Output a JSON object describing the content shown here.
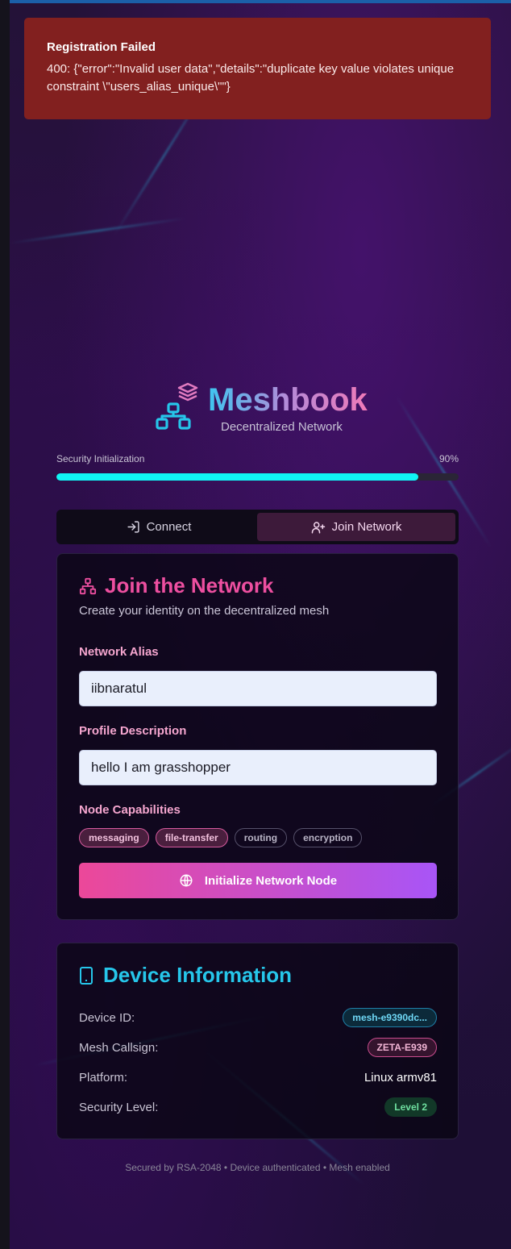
{
  "alert": {
    "title": "Registration Failed",
    "message": "400: {\"error\":\"Invalid user data\",\"details\":\"duplicate key value violates unique constraint \\\"users_alias_unique\\\"\"}"
  },
  "brand": {
    "name": "Meshbook",
    "tagline": "Decentralized Network",
    "icon": "network-stack-icon"
  },
  "security": {
    "label": "Security Initialization",
    "percent_text": "90%",
    "progress": 0.9
  },
  "tabs": [
    {
      "label": "Connect",
      "icon": "login-icon",
      "active": false
    },
    {
      "label": "Join Network",
      "icon": "user-plus-icon",
      "active": true
    }
  ],
  "join": {
    "title": "Join the Network",
    "subtitle": "Create your identity on the decentralized mesh",
    "alias_label": "Network Alias",
    "alias_value": "iibnaratul",
    "description_label": "Profile Description",
    "description_value": "hello I am grasshopper",
    "capabilities_label": "Node Capabilities",
    "capabilities": [
      {
        "label": "messaging",
        "selected": true
      },
      {
        "label": "file-transfer",
        "selected": true
      },
      {
        "label": "routing",
        "selected": false
      },
      {
        "label": "encryption",
        "selected": false
      }
    ],
    "submit_label": "Initialize Network Node"
  },
  "device": {
    "title": "Device Information",
    "rows": [
      {
        "label": "Device ID:",
        "value": "mesh-e9390dc..."
      },
      {
        "label": "Mesh Callsign:",
        "value": "ZETA-E939"
      },
      {
        "label": "Platform:",
        "value": "Linux armv81"
      },
      {
        "label": "Security Level:",
        "value": "Level 2"
      }
    ]
  },
  "footer": "Secured by RSA-2048 • Device authenticated • Mesh enabled",
  "colors": {
    "alert_bg": "#82201f",
    "progress": "#10f4f4",
    "pink": "#ee4fa0",
    "cyan": "#26c6ea",
    "button_from": "#ec4899",
    "button_to": "#a855f7"
  }
}
